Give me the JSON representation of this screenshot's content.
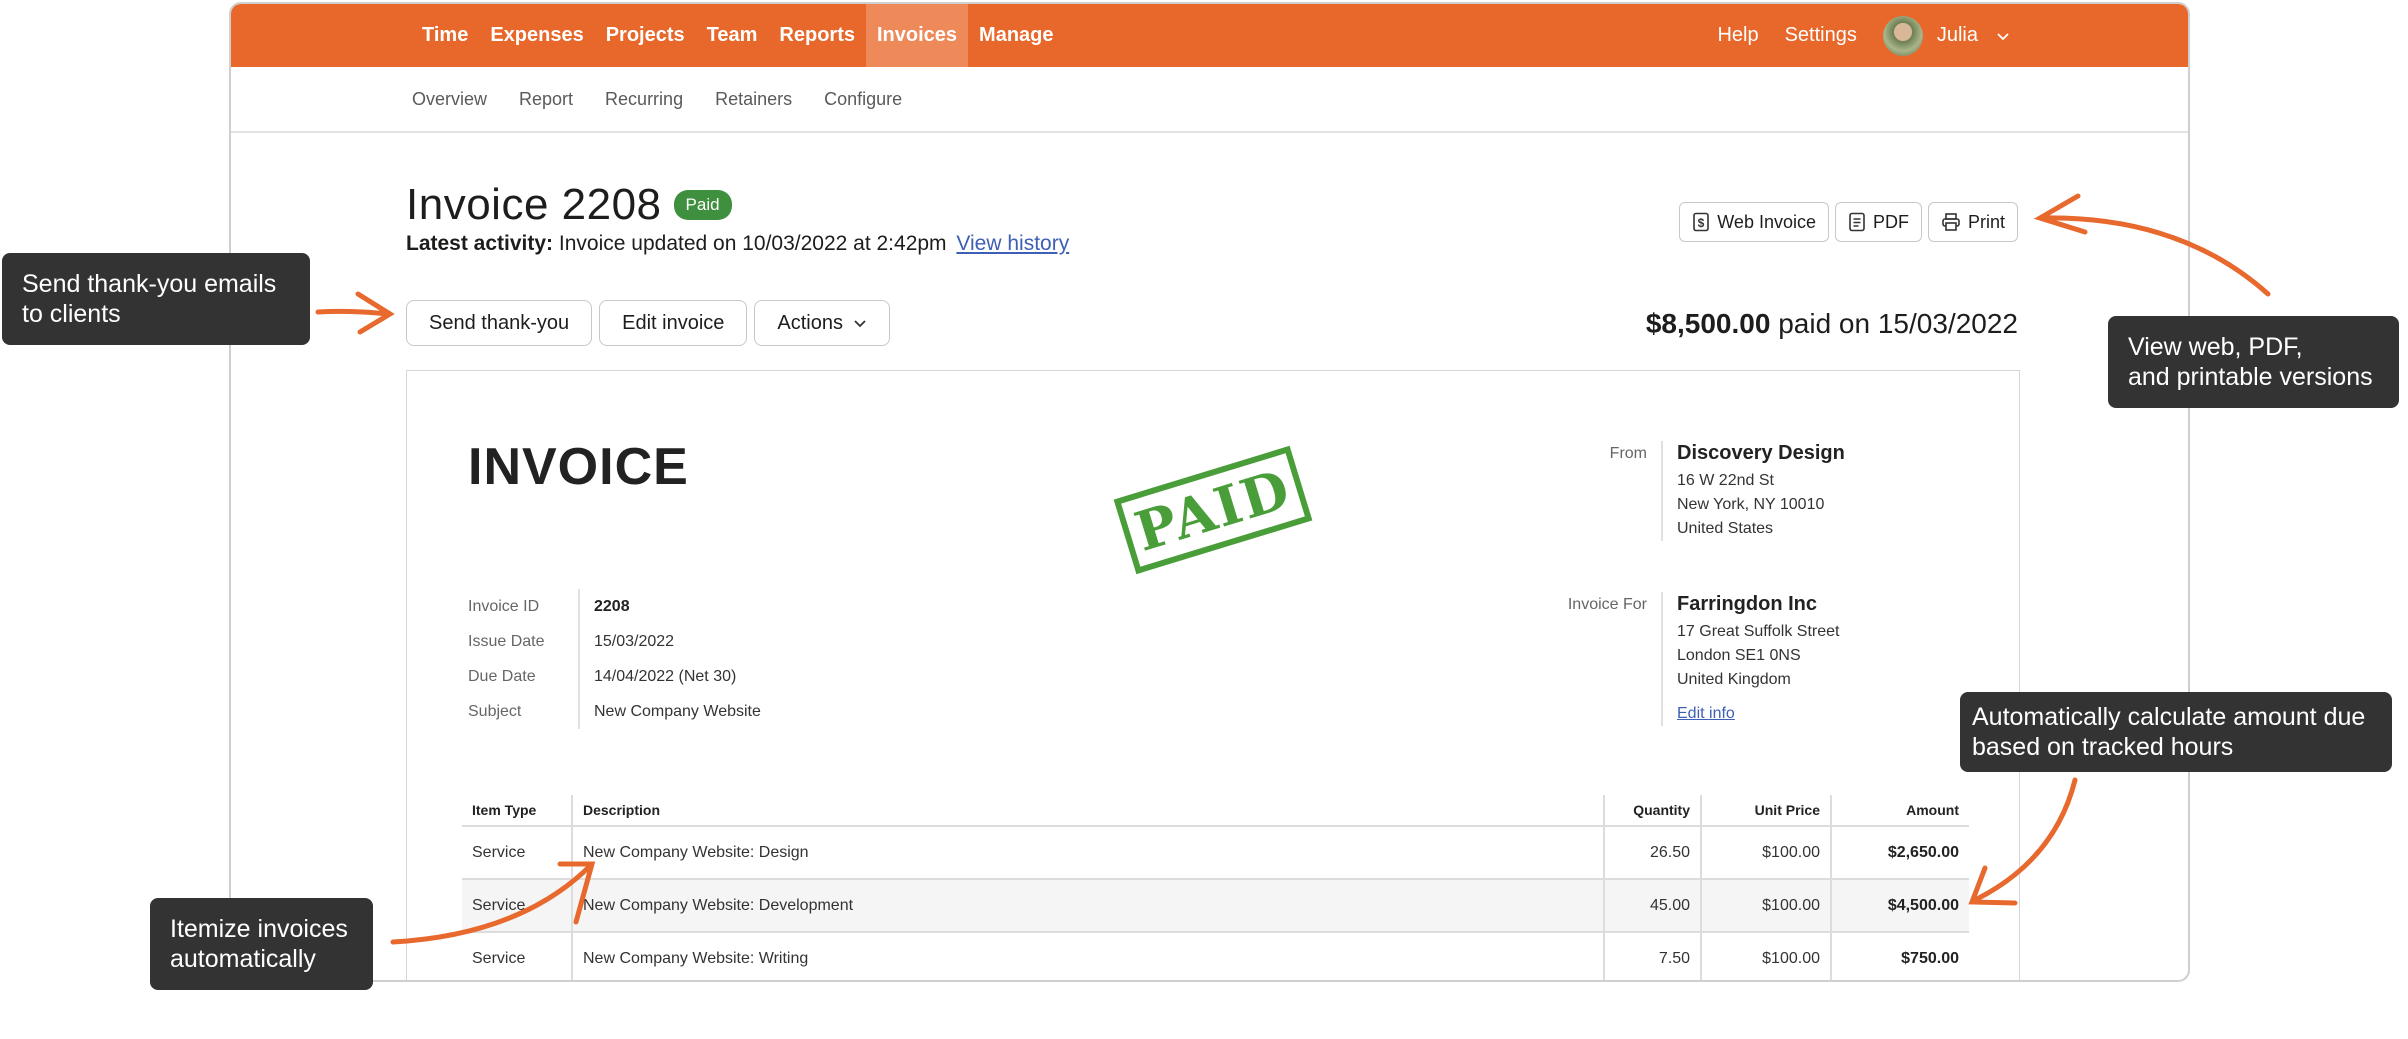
{
  "topnav": {
    "items": [
      {
        "label": "Time"
      },
      {
        "label": "Expenses"
      },
      {
        "label": "Projects"
      },
      {
        "label": "Team"
      },
      {
        "label": "Reports"
      },
      {
        "label": "Invoices",
        "active": true
      },
      {
        "label": "Manage"
      }
    ],
    "help": "Help",
    "settings": "Settings",
    "user": "Julia"
  },
  "subnav": {
    "items": [
      "Overview",
      "Report",
      "Recurring",
      "Retainers",
      "Configure"
    ]
  },
  "header": {
    "title": "Invoice 2208",
    "status": "Paid",
    "activity_label": "Latest activity:",
    "activity_text": "Invoice updated on 10/03/2022 at 2:42pm",
    "view_history": "View history"
  },
  "view_buttons": {
    "web_invoice": "Web Invoice",
    "pdf": "PDF",
    "print": "Print"
  },
  "actions": {
    "send_thank_you": "Send thank-you",
    "edit_invoice": "Edit invoice",
    "actions": "Actions"
  },
  "paid_summary": {
    "amount": "$8,500.00",
    "text": "paid on 15/03/2022"
  },
  "invoice": {
    "heading": "INVOICE",
    "stamp": "PAID",
    "from": {
      "label": "From",
      "name": "Discovery Design",
      "address": [
        "16 W 22nd St",
        "New York, NY 10010",
        "United States"
      ]
    },
    "for": {
      "label": "Invoice For",
      "name": "Farringdon Inc",
      "address": [
        "17 Great Suffolk Street",
        "London SE1 0NS",
        "United Kingdom"
      ],
      "edit_link": "Edit info"
    },
    "meta": {
      "labels": [
        "Invoice ID",
        "Issue Date",
        "Due Date",
        "Subject"
      ],
      "values": [
        "2208",
        "15/03/2022",
        "14/04/2022 (Net 30)",
        "New Company Website"
      ]
    },
    "table": {
      "columns": [
        "Item Type",
        "Description",
        "Quantity",
        "Unit Price",
        "Amount"
      ],
      "rows": [
        [
          "Service",
          "New Company Website: Design",
          "26.50",
          "$100.00",
          "$2,650.00"
        ],
        [
          "Service",
          "New Company Website: Development",
          "45.00",
          "$100.00",
          "$4,500.00"
        ],
        [
          "Service",
          "New Company Website: Writing",
          "7.50",
          "$100.00",
          "$750.00"
        ]
      ]
    }
  },
  "callouts": {
    "thank_you": [
      "Send thank-you emails",
      "to clients"
    ],
    "versions": [
      "View web, PDF,",
      "and printable versions"
    ],
    "calculate": [
      "Automatically calculate amount due",
      "based on tracked hours"
    ],
    "itemize": [
      "Itemize invoices",
      "automatically"
    ]
  },
  "colors": {
    "brand": "#e8672a",
    "paid_green": "#3e8f3e",
    "callout_bg": "#333333",
    "link": "#3d5fb5"
  }
}
